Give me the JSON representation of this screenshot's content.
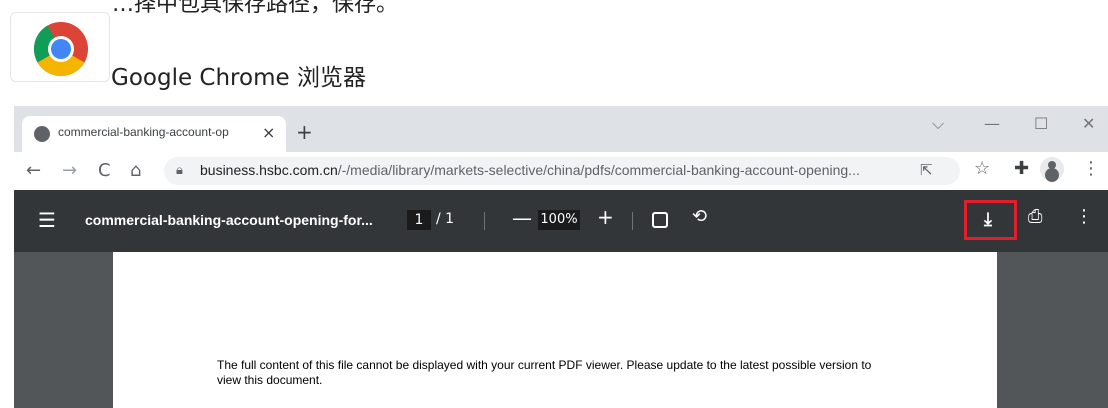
{
  "instruction": {
    "text": "…择中包具保存路径，保存。"
  },
  "app": {
    "name": "Google Chrome 浏览器"
  },
  "browser": {
    "tab": {
      "title": "commercial-banking-account-op",
      "close": "×"
    },
    "newtab": "+",
    "window_controls": {
      "tab_search": "⌵",
      "minimize": "—",
      "maximize": "☐",
      "close": "✕"
    },
    "toolbar": {
      "back": "←",
      "forward": "→",
      "reload": "C",
      "home": "⌂",
      "url_host": "business.hsbc.com.cn",
      "url_path": "/-/media/library/markets-selective/china/pdfs/commercial-banking-account-opening...",
      "share": "⇱",
      "bookmark": "☆",
      "extensions": "✚",
      "menu": "⋮"
    }
  },
  "pdf_viewer": {
    "menu": "☰",
    "title": "commercial-banking-account-opening-for...",
    "page_current": "1",
    "page_total": "/ 1",
    "zoom_out": "—",
    "zoom_level": "100%",
    "zoom_in": "+",
    "rotate": "⟲",
    "download": "⤓",
    "print": "⎙",
    "more": "⋮",
    "message": "The full content of this file cannot be displayed with your current PDF viewer. Please update to the latest possible version to view this document."
  },
  "colors": {
    "highlight": "#e41f2d",
    "pdf_toolbar": "#323639"
  }
}
